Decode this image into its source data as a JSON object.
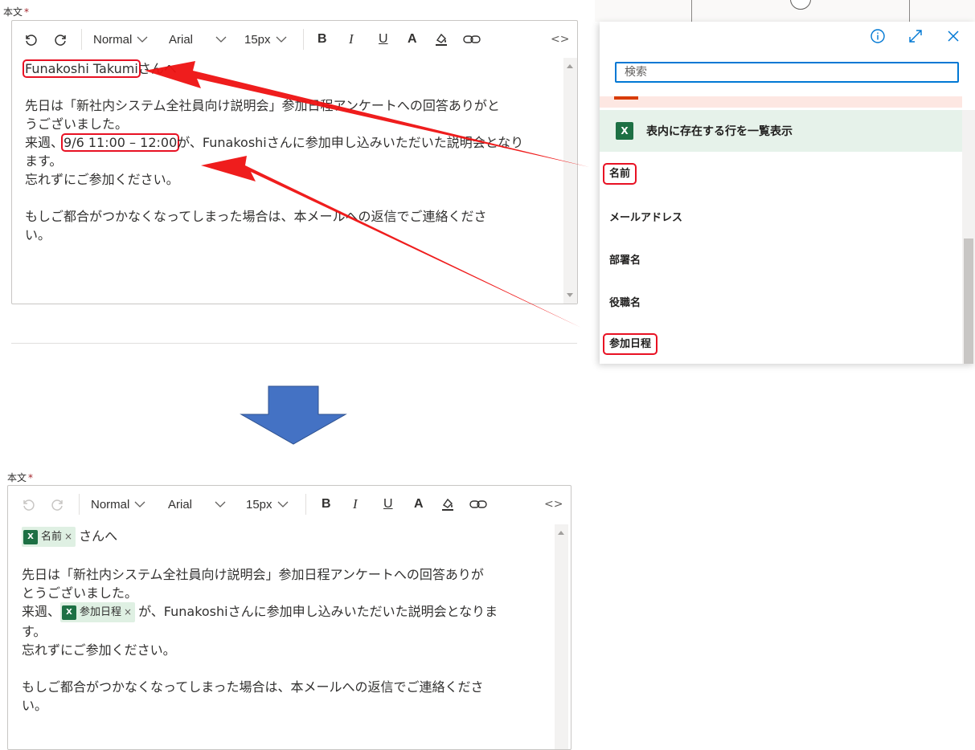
{
  "field_label": "本文",
  "required_mark": "*",
  "toolbar": {
    "style": "Normal",
    "font": "Arial",
    "size": "15px"
  },
  "before": {
    "greeting_name": "Funakoshi Takumi",
    "greeting_suffix": "さんへ",
    "line1a": "先日は「新社内システム全社員向け説明会」参加日程アンケートへの回答ありがと",
    "line1b": "うございました。",
    "line2_prefix": "来週、",
    "line2_schedule": "9/6 11:00 – 12:00",
    "line2a": "が、Funakoshiさんに参加申し込みいただいた説明会となり",
    "line2b": "ます。",
    "line3": "忘れずにご参加ください。",
    "line4a": "もしご都合がつかなくなってしまった場合は、本メールへの返信でご連絡くださ",
    "line4b": "い。"
  },
  "panel": {
    "search_placeholder": "検索",
    "section_title": "表内に存在する行を一覧表示",
    "items": [
      "名前",
      "メールアドレス",
      "部署名",
      "役職名",
      "参加日程"
    ]
  },
  "after": {
    "token_name": "名前",
    "greeting_suffix": "さんへ",
    "line1a": "先日は「新社内システム全社員向け説明会」参加日程アンケートへの回答ありが",
    "line1b": "とうございました。",
    "line2_prefix": "来週、",
    "token_schedule": "参加日程",
    "line2a": "が、Funakoshiさんに参加申し込みいただいた説明会となりま",
    "line2b": "す。",
    "line3": "忘れずにご参加ください。",
    "line4a": "もしご都合がつかなくなってしまった場合は、本メールへの返信でご連絡くださ",
    "line4b": "い。"
  },
  "token_remove": "×",
  "colors": {
    "accent": "#0078d4",
    "highlight": "#e81123",
    "excel": "#1d7044",
    "arrow": "#4472c4"
  }
}
